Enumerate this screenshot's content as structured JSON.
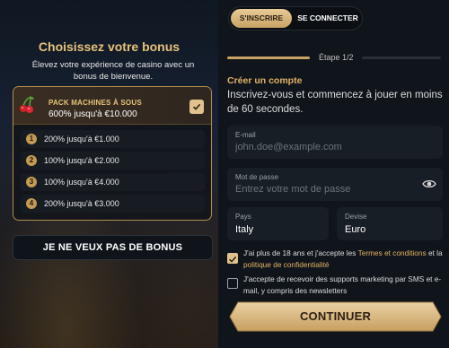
{
  "bonus_panel": {
    "title": "Choisissez votre bonus",
    "subtitle": "Élevez votre expérience de casino avec un bonus de bienvenue.",
    "selected_pack": {
      "name": "PACK MACHINES À SOUS",
      "amount": "600% jusqu'à €10.000",
      "icon": "cherry-icon"
    },
    "tiers": [
      {
        "num": "1",
        "label": "200% jusqu'à €1.000"
      },
      {
        "num": "2",
        "label": "100% jusqu'à €2.000"
      },
      {
        "num": "3",
        "label": "100% jusqu'à €4.000"
      },
      {
        "num": "4",
        "label": "200% jusqu'à €3.000"
      }
    ],
    "no_bonus_label": "JE NE VEUX PAS DE BONUS"
  },
  "auth": {
    "tabs": {
      "signup": "S'INSCRIRE",
      "login": "SE CONNECTER",
      "active": "signup"
    },
    "step_label": "Étape 1/2",
    "progress": 0.5,
    "create_title": "Créer un compte",
    "create_subtitle": "Inscrivez-vous et commencez à jouer en moins de 60 secondes.",
    "email": {
      "label": "E-mail",
      "placeholder": "john.doe@example.com",
      "value": ""
    },
    "password": {
      "label": "Mot de passe",
      "placeholder": "Entrez votre mot de passe",
      "value": "",
      "icon": "eye-icon"
    },
    "country": {
      "label": "Pays",
      "value": "Italy"
    },
    "currency": {
      "label": "Devise",
      "value": "Euro"
    },
    "consent_terms": {
      "checked": true,
      "prefix": "J'ai plus de 18 ans et j'accepte les ",
      "terms_link": "Termes et conditions",
      "middle": " et la ",
      "privacy_link": "politique de confidentialité"
    },
    "consent_marketing": {
      "checked": false,
      "text": "J'accepte de recevoir des supports marketing par SMS et e-mail, y compris des newsletters"
    },
    "continue_label": "CONTINUER"
  },
  "colors": {
    "accent_gold": "#e2b266",
    "button_gold": "#d8b47a",
    "background": "#10151b"
  }
}
